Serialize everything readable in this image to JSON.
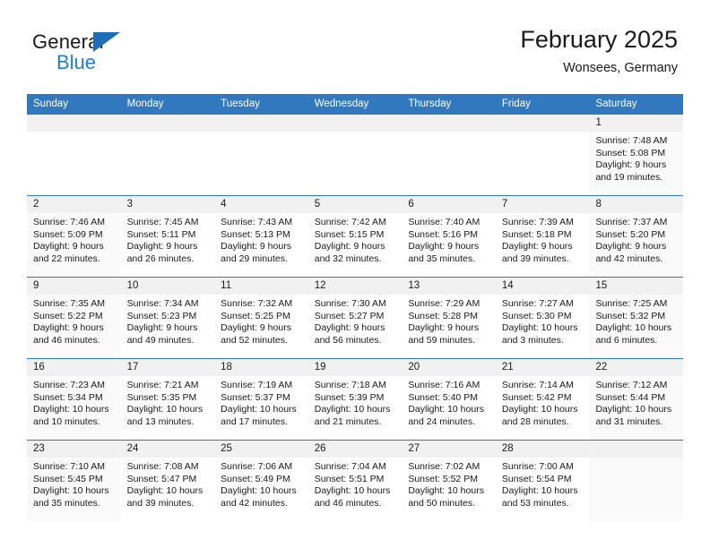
{
  "brand": {
    "name_top": "General",
    "name_bottom": "Blue",
    "accent_color": "#1f6eb5",
    "blue_text_color": "#1f7fd4"
  },
  "header": {
    "title": "February 2025",
    "subtitle": "Wonsees, Germany"
  },
  "theme": {
    "header_blue": "#3278be",
    "day_band_gray": "#f1f1f1",
    "text_color": "#1a1a1a"
  },
  "weekdays": [
    "Sunday",
    "Monday",
    "Tuesday",
    "Wednesday",
    "Thursday",
    "Friday",
    "Saturday"
  ],
  "labels": {
    "sunrise_prefix": "Sunrise: ",
    "sunset_prefix": "Sunset: ",
    "daylight_prefix": "Daylight: "
  },
  "weeks": [
    [
      {
        "day": "",
        "sunrise": "",
        "sunset": "",
        "daylight_line1": "",
        "daylight_line2": ""
      },
      {
        "day": "",
        "sunrise": "",
        "sunset": "",
        "daylight_line1": "",
        "daylight_line2": ""
      },
      {
        "day": "",
        "sunrise": "",
        "sunset": "",
        "daylight_line1": "",
        "daylight_line2": ""
      },
      {
        "day": "",
        "sunrise": "",
        "sunset": "",
        "daylight_line1": "",
        "daylight_line2": ""
      },
      {
        "day": "",
        "sunrise": "",
        "sunset": "",
        "daylight_line1": "",
        "daylight_line2": ""
      },
      {
        "day": "",
        "sunrise": "",
        "sunset": "",
        "daylight_line1": "",
        "daylight_line2": ""
      },
      {
        "day": "1",
        "sunrise": "Sunrise: 7:48 AM",
        "sunset": "Sunset: 5:08 PM",
        "daylight_line1": "Daylight: 9 hours",
        "daylight_line2": "and 19 minutes."
      }
    ],
    [
      {
        "day": "2",
        "sunrise": "Sunrise: 7:46 AM",
        "sunset": "Sunset: 5:09 PM",
        "daylight_line1": "Daylight: 9 hours",
        "daylight_line2": "and 22 minutes."
      },
      {
        "day": "3",
        "sunrise": "Sunrise: 7:45 AM",
        "sunset": "Sunset: 5:11 PM",
        "daylight_line1": "Daylight: 9 hours",
        "daylight_line2": "and 26 minutes."
      },
      {
        "day": "4",
        "sunrise": "Sunrise: 7:43 AM",
        "sunset": "Sunset: 5:13 PM",
        "daylight_line1": "Daylight: 9 hours",
        "daylight_line2": "and 29 minutes."
      },
      {
        "day": "5",
        "sunrise": "Sunrise: 7:42 AM",
        "sunset": "Sunset: 5:15 PM",
        "daylight_line1": "Daylight: 9 hours",
        "daylight_line2": "and 32 minutes."
      },
      {
        "day": "6",
        "sunrise": "Sunrise: 7:40 AM",
        "sunset": "Sunset: 5:16 PM",
        "daylight_line1": "Daylight: 9 hours",
        "daylight_line2": "and 35 minutes."
      },
      {
        "day": "7",
        "sunrise": "Sunrise: 7:39 AM",
        "sunset": "Sunset: 5:18 PM",
        "daylight_line1": "Daylight: 9 hours",
        "daylight_line2": "and 39 minutes."
      },
      {
        "day": "8",
        "sunrise": "Sunrise: 7:37 AM",
        "sunset": "Sunset: 5:20 PM",
        "daylight_line1": "Daylight: 9 hours",
        "daylight_line2": "and 42 minutes."
      }
    ],
    [
      {
        "day": "9",
        "sunrise": "Sunrise: 7:35 AM",
        "sunset": "Sunset: 5:22 PM",
        "daylight_line1": "Daylight: 9 hours",
        "daylight_line2": "and 46 minutes."
      },
      {
        "day": "10",
        "sunrise": "Sunrise: 7:34 AM",
        "sunset": "Sunset: 5:23 PM",
        "daylight_line1": "Daylight: 9 hours",
        "daylight_line2": "and 49 minutes."
      },
      {
        "day": "11",
        "sunrise": "Sunrise: 7:32 AM",
        "sunset": "Sunset: 5:25 PM",
        "daylight_line1": "Daylight: 9 hours",
        "daylight_line2": "and 52 minutes."
      },
      {
        "day": "12",
        "sunrise": "Sunrise: 7:30 AM",
        "sunset": "Sunset: 5:27 PM",
        "daylight_line1": "Daylight: 9 hours",
        "daylight_line2": "and 56 minutes."
      },
      {
        "day": "13",
        "sunrise": "Sunrise: 7:29 AM",
        "sunset": "Sunset: 5:28 PM",
        "daylight_line1": "Daylight: 9 hours",
        "daylight_line2": "and 59 minutes."
      },
      {
        "day": "14",
        "sunrise": "Sunrise: 7:27 AM",
        "sunset": "Sunset: 5:30 PM",
        "daylight_line1": "Daylight: 10 hours",
        "daylight_line2": "and 3 minutes."
      },
      {
        "day": "15",
        "sunrise": "Sunrise: 7:25 AM",
        "sunset": "Sunset: 5:32 PM",
        "daylight_line1": "Daylight: 10 hours",
        "daylight_line2": "and 6 minutes."
      }
    ],
    [
      {
        "day": "16",
        "sunrise": "Sunrise: 7:23 AM",
        "sunset": "Sunset: 5:34 PM",
        "daylight_line1": "Daylight: 10 hours",
        "daylight_line2": "and 10 minutes."
      },
      {
        "day": "17",
        "sunrise": "Sunrise: 7:21 AM",
        "sunset": "Sunset: 5:35 PM",
        "daylight_line1": "Daylight: 10 hours",
        "daylight_line2": "and 13 minutes."
      },
      {
        "day": "18",
        "sunrise": "Sunrise: 7:19 AM",
        "sunset": "Sunset: 5:37 PM",
        "daylight_line1": "Daylight: 10 hours",
        "daylight_line2": "and 17 minutes."
      },
      {
        "day": "19",
        "sunrise": "Sunrise: 7:18 AM",
        "sunset": "Sunset: 5:39 PM",
        "daylight_line1": "Daylight: 10 hours",
        "daylight_line2": "and 21 minutes."
      },
      {
        "day": "20",
        "sunrise": "Sunrise: 7:16 AM",
        "sunset": "Sunset: 5:40 PM",
        "daylight_line1": "Daylight: 10 hours",
        "daylight_line2": "and 24 minutes."
      },
      {
        "day": "21",
        "sunrise": "Sunrise: 7:14 AM",
        "sunset": "Sunset: 5:42 PM",
        "daylight_line1": "Daylight: 10 hours",
        "daylight_line2": "and 28 minutes."
      },
      {
        "day": "22",
        "sunrise": "Sunrise: 7:12 AM",
        "sunset": "Sunset: 5:44 PM",
        "daylight_line1": "Daylight: 10 hours",
        "daylight_line2": "and 31 minutes."
      }
    ],
    [
      {
        "day": "23",
        "sunrise": "Sunrise: 7:10 AM",
        "sunset": "Sunset: 5:45 PM",
        "daylight_line1": "Daylight: 10 hours",
        "daylight_line2": "and 35 minutes."
      },
      {
        "day": "24",
        "sunrise": "Sunrise: 7:08 AM",
        "sunset": "Sunset: 5:47 PM",
        "daylight_line1": "Daylight: 10 hours",
        "daylight_line2": "and 39 minutes."
      },
      {
        "day": "25",
        "sunrise": "Sunrise: 7:06 AM",
        "sunset": "Sunset: 5:49 PM",
        "daylight_line1": "Daylight: 10 hours",
        "daylight_line2": "and 42 minutes."
      },
      {
        "day": "26",
        "sunrise": "Sunrise: 7:04 AM",
        "sunset": "Sunset: 5:51 PM",
        "daylight_line1": "Daylight: 10 hours",
        "daylight_line2": "and 46 minutes."
      },
      {
        "day": "27",
        "sunrise": "Sunrise: 7:02 AM",
        "sunset": "Sunset: 5:52 PM",
        "daylight_line1": "Daylight: 10 hours",
        "daylight_line2": "and 50 minutes."
      },
      {
        "day": "28",
        "sunrise": "Sunrise: 7:00 AM",
        "sunset": "Sunset: 5:54 PM",
        "daylight_line1": "Daylight: 10 hours",
        "daylight_line2": "and 53 minutes."
      },
      {
        "day": "",
        "sunrise": "",
        "sunset": "",
        "daylight_line1": "",
        "daylight_line2": ""
      }
    ]
  ]
}
